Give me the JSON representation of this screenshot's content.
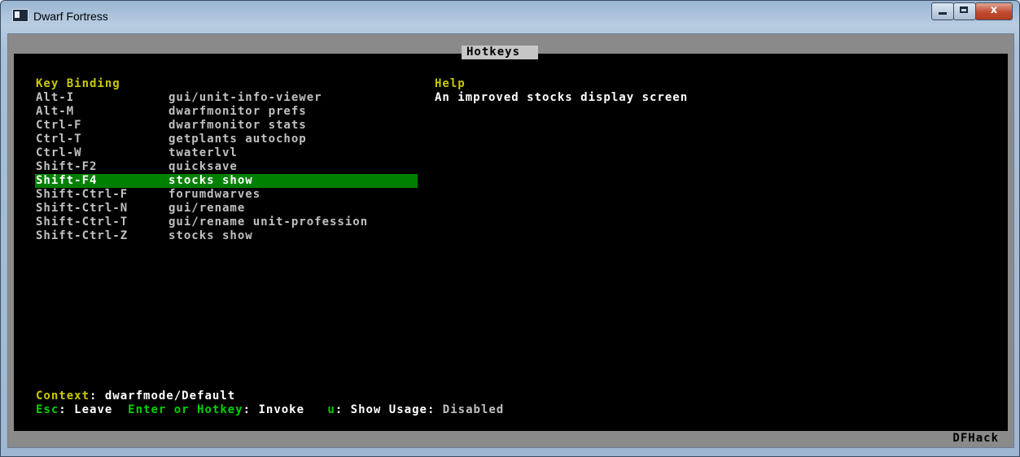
{
  "window": {
    "title": "Dwarf Fortress",
    "controls": {
      "minimize": "minimize",
      "maximize": "maximize",
      "close": "x"
    }
  },
  "screen": {
    "title": "Hotkeys",
    "columns": {
      "key": "Key Binding",
      "help": "Help"
    },
    "bindings": [
      {
        "key": "Alt-I",
        "command": "gui/unit-info-viewer"
      },
      {
        "key": "Alt-M",
        "command": "dwarfmonitor prefs"
      },
      {
        "key": "Ctrl-F",
        "command": "dwarfmonitor stats"
      },
      {
        "key": "Ctrl-T",
        "command": "getplants autochop"
      },
      {
        "key": "Ctrl-W",
        "command": "twaterlvl"
      },
      {
        "key": "Shift-F2",
        "command": "quicksave"
      },
      {
        "key": "Shift-F4",
        "command": "stocks show",
        "selected": true
      },
      {
        "key": "Shift-Ctrl-F",
        "command": "forumdwarves"
      },
      {
        "key": "Shift-Ctrl-N",
        "command": "gui/rename"
      },
      {
        "key": "Shift-Ctrl-T",
        "command": "gui/rename unit-profession"
      },
      {
        "key": "Shift-Ctrl-Z",
        "command": "stocks show"
      }
    ],
    "help_text": "An improved stocks display screen",
    "context": {
      "label": "Context",
      "value": "dwarfmode/Default"
    },
    "footer": {
      "esc_key": "Esc",
      "esc_action": "Leave",
      "enter_key": "Enter or Hotkey",
      "enter_action": "Invoke",
      "usage_key": "u",
      "usage_action": "Show Usage",
      "usage_state": "Disabled"
    },
    "brand": "DFHack"
  },
  "colors": {
    "selected_row": "#008000",
    "heading": "#c9c900",
    "hotkey": "#00d000",
    "text": "#c0c0c0",
    "frame": "#8a8a8a"
  }
}
